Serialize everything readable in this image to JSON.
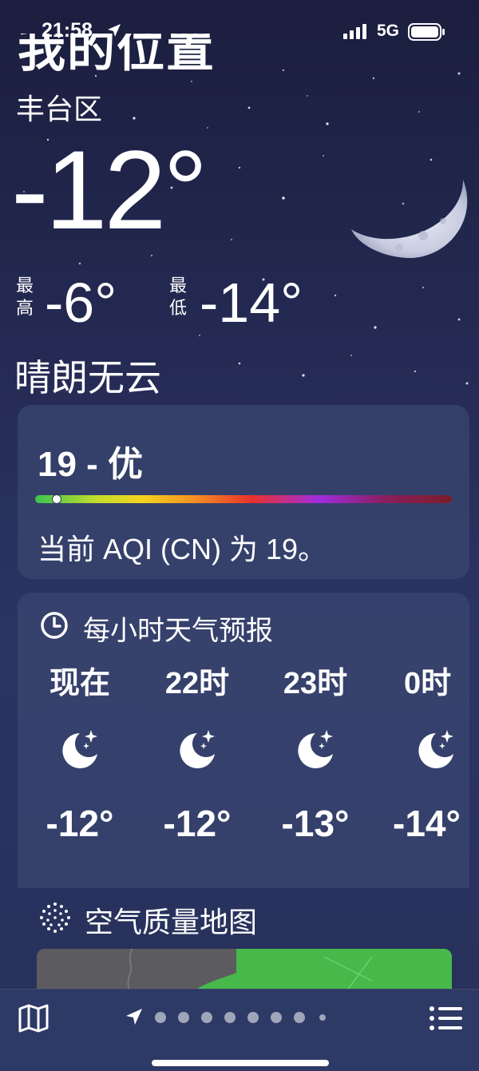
{
  "status_bar": {
    "time": "21:58",
    "network": "5G"
  },
  "location": {
    "title": "我的位置",
    "district": "丰台区"
  },
  "current": {
    "temperature": "-12°",
    "high_label": "最高",
    "high": "-6°",
    "low_label": "最低",
    "low": "-14°",
    "condition": "晴朗无云"
  },
  "aqi": {
    "value_text": "19 - 优",
    "description": "当前 AQI (CN) 为 19。",
    "level_fraction": 0.04
  },
  "hourly": {
    "title": "每小时天气预报",
    "items": [
      {
        "label": "现在",
        "icon": "moon-stars-icon",
        "temp": "-12°"
      },
      {
        "label": "22时",
        "icon": "moon-stars-icon",
        "temp": "-12°"
      },
      {
        "label": "23时",
        "icon": "moon-stars-icon",
        "temp": "-13°"
      },
      {
        "label": "0时",
        "icon": "moon-stars-icon",
        "temp": "-14°"
      }
    ]
  },
  "air_quality_map": {
    "title": "空气质量地图"
  },
  "bottom_bar": {
    "page_count": 8,
    "icons": [
      "map-icon",
      "location-arrow-icon",
      "list-icon"
    ]
  },
  "colors": {
    "aqi_good": "#39c64c",
    "map_green": "#47b84a"
  }
}
